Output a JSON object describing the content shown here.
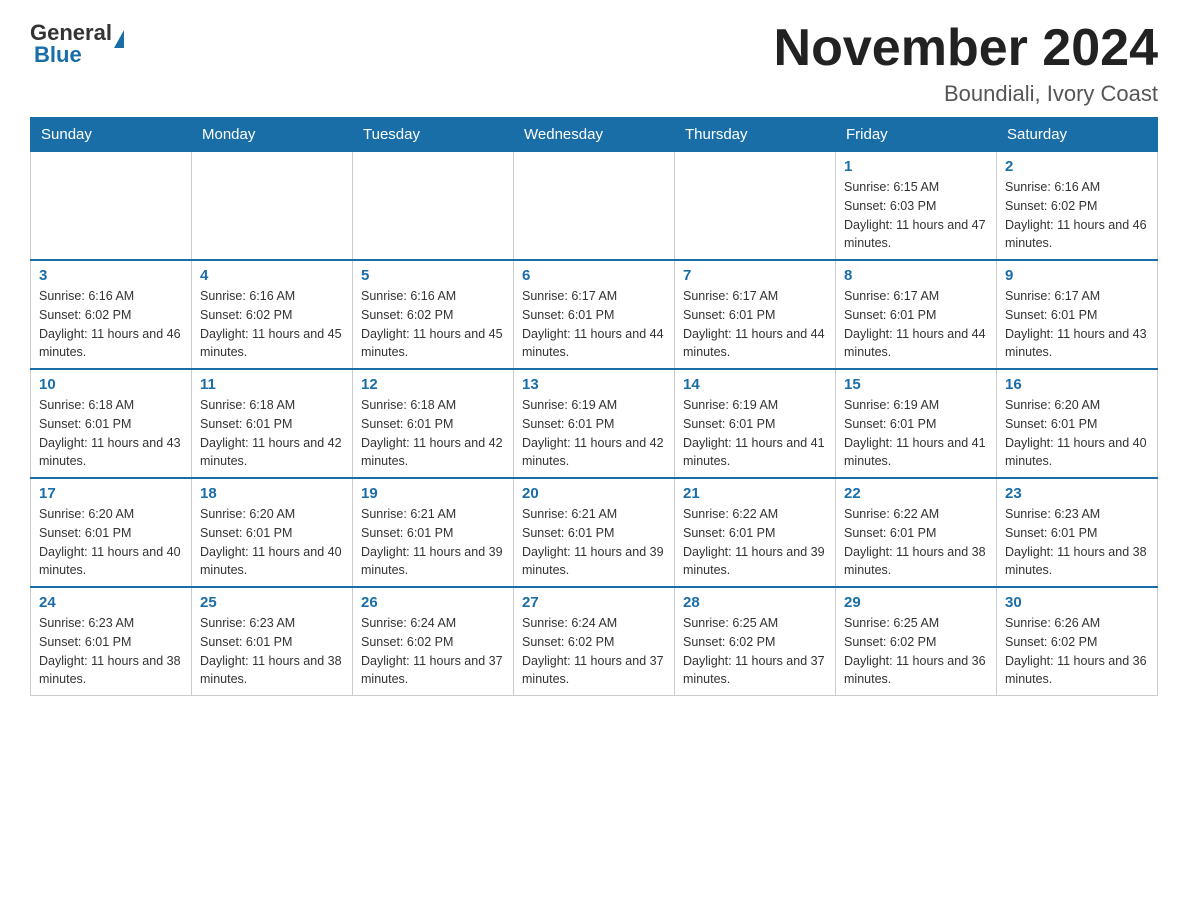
{
  "logo": {
    "general": "General",
    "blue": "Blue"
  },
  "title": "November 2024",
  "location": "Boundiali, Ivory Coast",
  "weekdays": [
    "Sunday",
    "Monday",
    "Tuesday",
    "Wednesday",
    "Thursday",
    "Friday",
    "Saturday"
  ],
  "weeks": [
    [
      {
        "day": "",
        "info": ""
      },
      {
        "day": "",
        "info": ""
      },
      {
        "day": "",
        "info": ""
      },
      {
        "day": "",
        "info": ""
      },
      {
        "day": "",
        "info": ""
      },
      {
        "day": "1",
        "info": "Sunrise: 6:15 AM\nSunset: 6:03 PM\nDaylight: 11 hours and 47 minutes."
      },
      {
        "day": "2",
        "info": "Sunrise: 6:16 AM\nSunset: 6:02 PM\nDaylight: 11 hours and 46 minutes."
      }
    ],
    [
      {
        "day": "3",
        "info": "Sunrise: 6:16 AM\nSunset: 6:02 PM\nDaylight: 11 hours and 46 minutes."
      },
      {
        "day": "4",
        "info": "Sunrise: 6:16 AM\nSunset: 6:02 PM\nDaylight: 11 hours and 45 minutes."
      },
      {
        "day": "5",
        "info": "Sunrise: 6:16 AM\nSunset: 6:02 PM\nDaylight: 11 hours and 45 minutes."
      },
      {
        "day": "6",
        "info": "Sunrise: 6:17 AM\nSunset: 6:01 PM\nDaylight: 11 hours and 44 minutes."
      },
      {
        "day": "7",
        "info": "Sunrise: 6:17 AM\nSunset: 6:01 PM\nDaylight: 11 hours and 44 minutes."
      },
      {
        "day": "8",
        "info": "Sunrise: 6:17 AM\nSunset: 6:01 PM\nDaylight: 11 hours and 44 minutes."
      },
      {
        "day": "9",
        "info": "Sunrise: 6:17 AM\nSunset: 6:01 PM\nDaylight: 11 hours and 43 minutes."
      }
    ],
    [
      {
        "day": "10",
        "info": "Sunrise: 6:18 AM\nSunset: 6:01 PM\nDaylight: 11 hours and 43 minutes."
      },
      {
        "day": "11",
        "info": "Sunrise: 6:18 AM\nSunset: 6:01 PM\nDaylight: 11 hours and 42 minutes."
      },
      {
        "day": "12",
        "info": "Sunrise: 6:18 AM\nSunset: 6:01 PM\nDaylight: 11 hours and 42 minutes."
      },
      {
        "day": "13",
        "info": "Sunrise: 6:19 AM\nSunset: 6:01 PM\nDaylight: 11 hours and 42 minutes."
      },
      {
        "day": "14",
        "info": "Sunrise: 6:19 AM\nSunset: 6:01 PM\nDaylight: 11 hours and 41 minutes."
      },
      {
        "day": "15",
        "info": "Sunrise: 6:19 AM\nSunset: 6:01 PM\nDaylight: 11 hours and 41 minutes."
      },
      {
        "day": "16",
        "info": "Sunrise: 6:20 AM\nSunset: 6:01 PM\nDaylight: 11 hours and 40 minutes."
      }
    ],
    [
      {
        "day": "17",
        "info": "Sunrise: 6:20 AM\nSunset: 6:01 PM\nDaylight: 11 hours and 40 minutes."
      },
      {
        "day": "18",
        "info": "Sunrise: 6:20 AM\nSunset: 6:01 PM\nDaylight: 11 hours and 40 minutes."
      },
      {
        "day": "19",
        "info": "Sunrise: 6:21 AM\nSunset: 6:01 PM\nDaylight: 11 hours and 39 minutes."
      },
      {
        "day": "20",
        "info": "Sunrise: 6:21 AM\nSunset: 6:01 PM\nDaylight: 11 hours and 39 minutes."
      },
      {
        "day": "21",
        "info": "Sunrise: 6:22 AM\nSunset: 6:01 PM\nDaylight: 11 hours and 39 minutes."
      },
      {
        "day": "22",
        "info": "Sunrise: 6:22 AM\nSunset: 6:01 PM\nDaylight: 11 hours and 38 minutes."
      },
      {
        "day": "23",
        "info": "Sunrise: 6:23 AM\nSunset: 6:01 PM\nDaylight: 11 hours and 38 minutes."
      }
    ],
    [
      {
        "day": "24",
        "info": "Sunrise: 6:23 AM\nSunset: 6:01 PM\nDaylight: 11 hours and 38 minutes."
      },
      {
        "day": "25",
        "info": "Sunrise: 6:23 AM\nSunset: 6:01 PM\nDaylight: 11 hours and 38 minutes."
      },
      {
        "day": "26",
        "info": "Sunrise: 6:24 AM\nSunset: 6:02 PM\nDaylight: 11 hours and 37 minutes."
      },
      {
        "day": "27",
        "info": "Sunrise: 6:24 AM\nSunset: 6:02 PM\nDaylight: 11 hours and 37 minutes."
      },
      {
        "day": "28",
        "info": "Sunrise: 6:25 AM\nSunset: 6:02 PM\nDaylight: 11 hours and 37 minutes."
      },
      {
        "day": "29",
        "info": "Sunrise: 6:25 AM\nSunset: 6:02 PM\nDaylight: 11 hours and 36 minutes."
      },
      {
        "day": "30",
        "info": "Sunrise: 6:26 AM\nSunset: 6:02 PM\nDaylight: 11 hours and 36 minutes."
      }
    ]
  ]
}
